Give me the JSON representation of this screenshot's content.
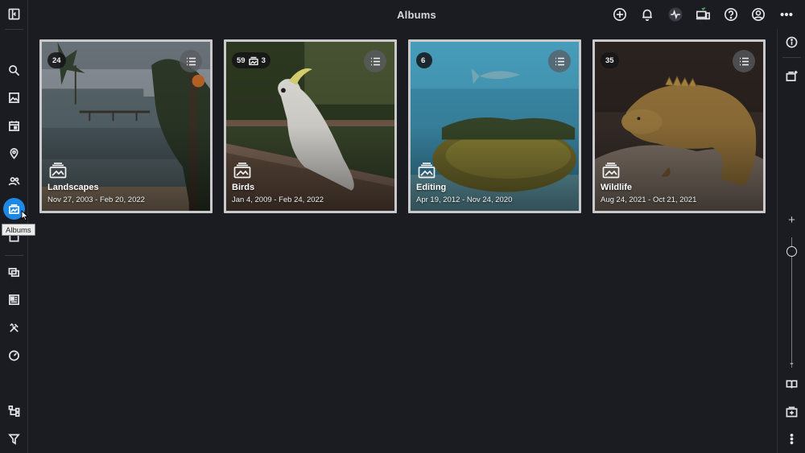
{
  "header": {
    "title": "Albums"
  },
  "top_actions": [
    {
      "name": "add-icon"
    },
    {
      "name": "bell-icon"
    },
    {
      "name": "activity-icon"
    },
    {
      "name": "devices-icon"
    },
    {
      "name": "help-icon"
    },
    {
      "name": "account-icon"
    },
    {
      "name": "more-horizontal-icon"
    }
  ],
  "left_nav": [
    "toggle-sidebar-icon",
    "search-icon",
    "photo-icon",
    "calendar-icon",
    "location-icon",
    "people-icon",
    "albums-icon",
    "frame-icon",
    "collections-icon",
    "dashboard-icon",
    "tools-icon",
    "speedometer-icon",
    "hierarchy-icon",
    "filter-icon"
  ],
  "tooltip": {
    "text": "Albums"
  },
  "albums": [
    {
      "count": "24",
      "sub_count": "",
      "name": "Landscapes",
      "dates": "Nov 27, 2003 - Feb 20, 2022"
    },
    {
      "count": "59",
      "sub_count": "3",
      "name": "Birds",
      "dates": "Jan 4, 2009 - Feb 24, 2022"
    },
    {
      "count": "6",
      "sub_count": "",
      "name": "Editing",
      "dates": "Apr 19, 2012 - Nov 24, 2020"
    },
    {
      "count": "35",
      "sub_count": "",
      "name": "Wildlife",
      "dates": "Aug 24, 2021 - Oct 21, 2021"
    }
  ],
  "right_panel": {
    "zoom_plus": "+",
    "zoom_minus": "-",
    "zoom_level": 0.11
  },
  "colors": {
    "accent": "#1e88e5",
    "background": "#1b1c22",
    "card_border": "#c9c9cc"
  }
}
